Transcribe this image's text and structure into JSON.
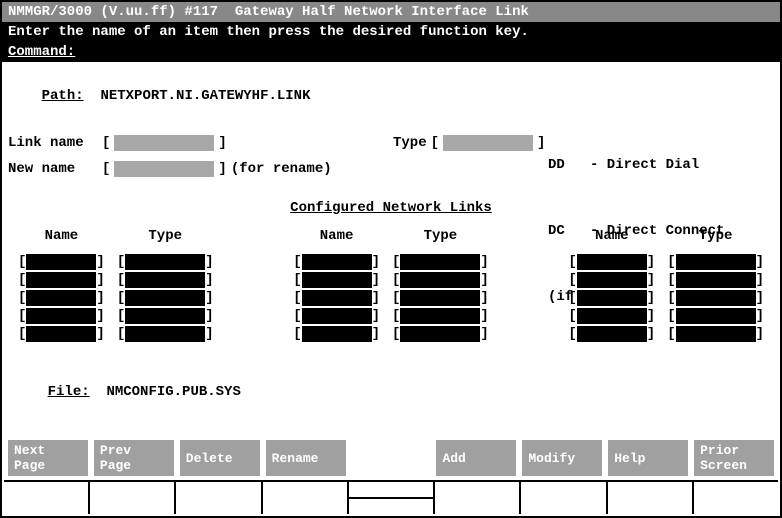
{
  "header": {
    "title": "NMMGR/3000 (V.uu.ff) #117  Gateway Half Network Interface Link",
    "instruction": "Enter the name of an item then press the desired function key.",
    "command_label": "Command:",
    "command_value": ""
  },
  "path": {
    "label": "Path:",
    "value": "NETXPORT.NI.GATEWYHF.LINK"
  },
  "form": {
    "link_name_label": "Link name",
    "link_name_value": "",
    "new_name_label": "New name",
    "new_name_value": "",
    "rename_hint": "(for rename)",
    "type_label": "Type",
    "type_value": "",
    "legend_dd": "DD   - Direct Dial",
    "legend_dc": "DC   - Direct Connect",
    "legend_ifnew": "(if new)"
  },
  "section_title": "Configured Network Links",
  "columns": {
    "name": "Name",
    "type": "Type"
  },
  "links": {
    "col1": [
      {
        "name": "",
        "type": ""
      },
      {
        "name": "",
        "type": ""
      },
      {
        "name": "",
        "type": ""
      },
      {
        "name": "",
        "type": ""
      },
      {
        "name": "",
        "type": ""
      }
    ],
    "col2": [
      {
        "name": "",
        "type": ""
      },
      {
        "name": "",
        "type": ""
      },
      {
        "name": "",
        "type": ""
      },
      {
        "name": "",
        "type": ""
      },
      {
        "name": "",
        "type": ""
      }
    ],
    "col3": [
      {
        "name": "",
        "type": ""
      },
      {
        "name": "",
        "type": ""
      },
      {
        "name": "",
        "type": ""
      },
      {
        "name": "",
        "type": ""
      },
      {
        "name": "",
        "type": ""
      }
    ]
  },
  "file": {
    "label": "File:",
    "value": "NMCONFIG.PUB.SYS"
  },
  "fkeys": {
    "f1": "Next\nPage",
    "f2": "Prev\nPage",
    "f3": "Delete",
    "f4": "Rename",
    "f5": "Add",
    "f6": "Modify",
    "f7": "Help",
    "f8": "Prior\nScreen"
  }
}
